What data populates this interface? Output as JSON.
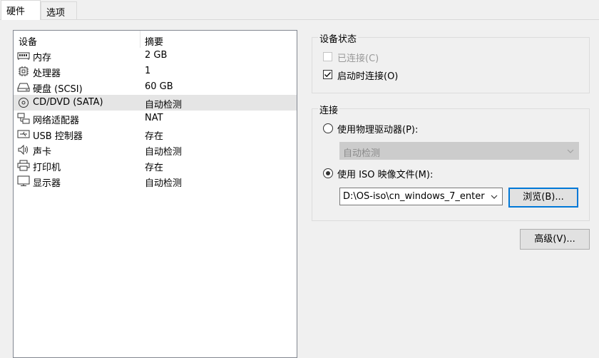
{
  "tabs": [
    {
      "label": "硬件",
      "active": true
    },
    {
      "label": "选项",
      "active": false
    }
  ],
  "device_list": {
    "headers": {
      "device": "设备",
      "summary": "摘要"
    },
    "rows": [
      {
        "icon": "memory-icon",
        "name": "内存",
        "summary": "2 GB"
      },
      {
        "icon": "cpu-icon",
        "name": "处理器",
        "summary": "1"
      },
      {
        "icon": "hard-disk-icon",
        "name": "硬盘 (SCSI)",
        "summary": "60 GB"
      },
      {
        "icon": "cd-dvd-icon",
        "name": "CD/DVD (SATA)",
        "summary": "自动检测",
        "selected": true
      },
      {
        "icon": "network-adapter-icon",
        "name": "网络适配器",
        "summary": "NAT"
      },
      {
        "icon": "usb-icon",
        "name": "USB 控制器",
        "summary": "存在"
      },
      {
        "icon": "speaker-icon",
        "name": "声卡",
        "summary": "自动检测"
      },
      {
        "icon": "printer-icon",
        "name": "打印机",
        "summary": "存在"
      },
      {
        "icon": "monitor-icon",
        "name": "显示器",
        "summary": "自动检测"
      }
    ]
  },
  "device_status": {
    "title": "设备状态",
    "connected": {
      "label": "已连接(C)",
      "checked": false,
      "disabled": true
    },
    "connect_at_power_on": {
      "label": "启动时连接(O)",
      "checked": true
    }
  },
  "connection": {
    "title": "连接",
    "physical_drive": {
      "label": "使用物理驱动器(P):",
      "selected": false
    },
    "physical_drive_select": {
      "value": "自动检测",
      "disabled": true
    },
    "iso_image": {
      "label": "使用 ISO 映像文件(M):",
      "selected": true
    },
    "iso_path": {
      "value": "D:\\OS-iso\\cn_windows_7_enter"
    },
    "browse_button": "浏览(B)..."
  },
  "advanced_button": "高级(V)...",
  "colors": {
    "selected_row": "#e5e5e5",
    "focus_border": "#0078d7",
    "window_bg": "#f0f0f0"
  }
}
